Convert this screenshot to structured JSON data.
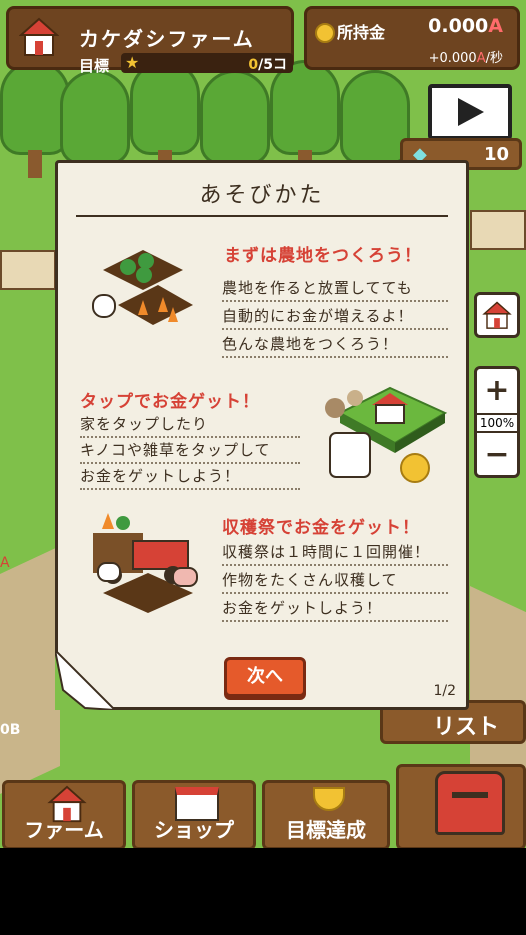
{
  "header": {
    "farm_name": "カケダシファーム",
    "goal_label": "目標",
    "goal_current": "0",
    "goal_total": "/5コ",
    "money_label": "所持金",
    "money_value": "0.000",
    "money_unit": "A",
    "rate_prefix": "+0.000",
    "rate_unit": "A",
    "rate_suffix": "/秒"
  },
  "gems": {
    "count": "10"
  },
  "zoom": {
    "plus": "+",
    "level": "100%",
    "minus": "−"
  },
  "modal": {
    "title": "あそびかた",
    "sections": [
      {
        "heading": "まずは農地をつくろう！",
        "lines": [
          "農地を作ると放置してても",
          "自動的にお金が増えるよ！",
          "色んな農地をつくろう！"
        ]
      },
      {
        "heading": "タップでお金ゲット！",
        "lines": [
          "家をタップしたり",
          "キノコや雑草をタップして",
          "お金をゲットしよう！"
        ]
      },
      {
        "heading": "収穫祭でお金をゲット！",
        "lines": [
          "収穫祭は１時間に１回開催！",
          "作物をたくさん収穫して",
          "お金をゲットしよう！"
        ]
      }
    ],
    "next_label": "次へ",
    "page": "1/2"
  },
  "behind": {
    "list_label": "リスト",
    "edge_a": "A",
    "edge_b": "0B"
  },
  "nav": [
    {
      "label": "ファーム"
    },
    {
      "label": "ショップ"
    },
    {
      "label": "目標達成"
    }
  ],
  "colors": {
    "accent_red": "#d64236",
    "button_orange": "#e55a2b",
    "wood": "#6e4420",
    "grass": "#7fc04a"
  }
}
